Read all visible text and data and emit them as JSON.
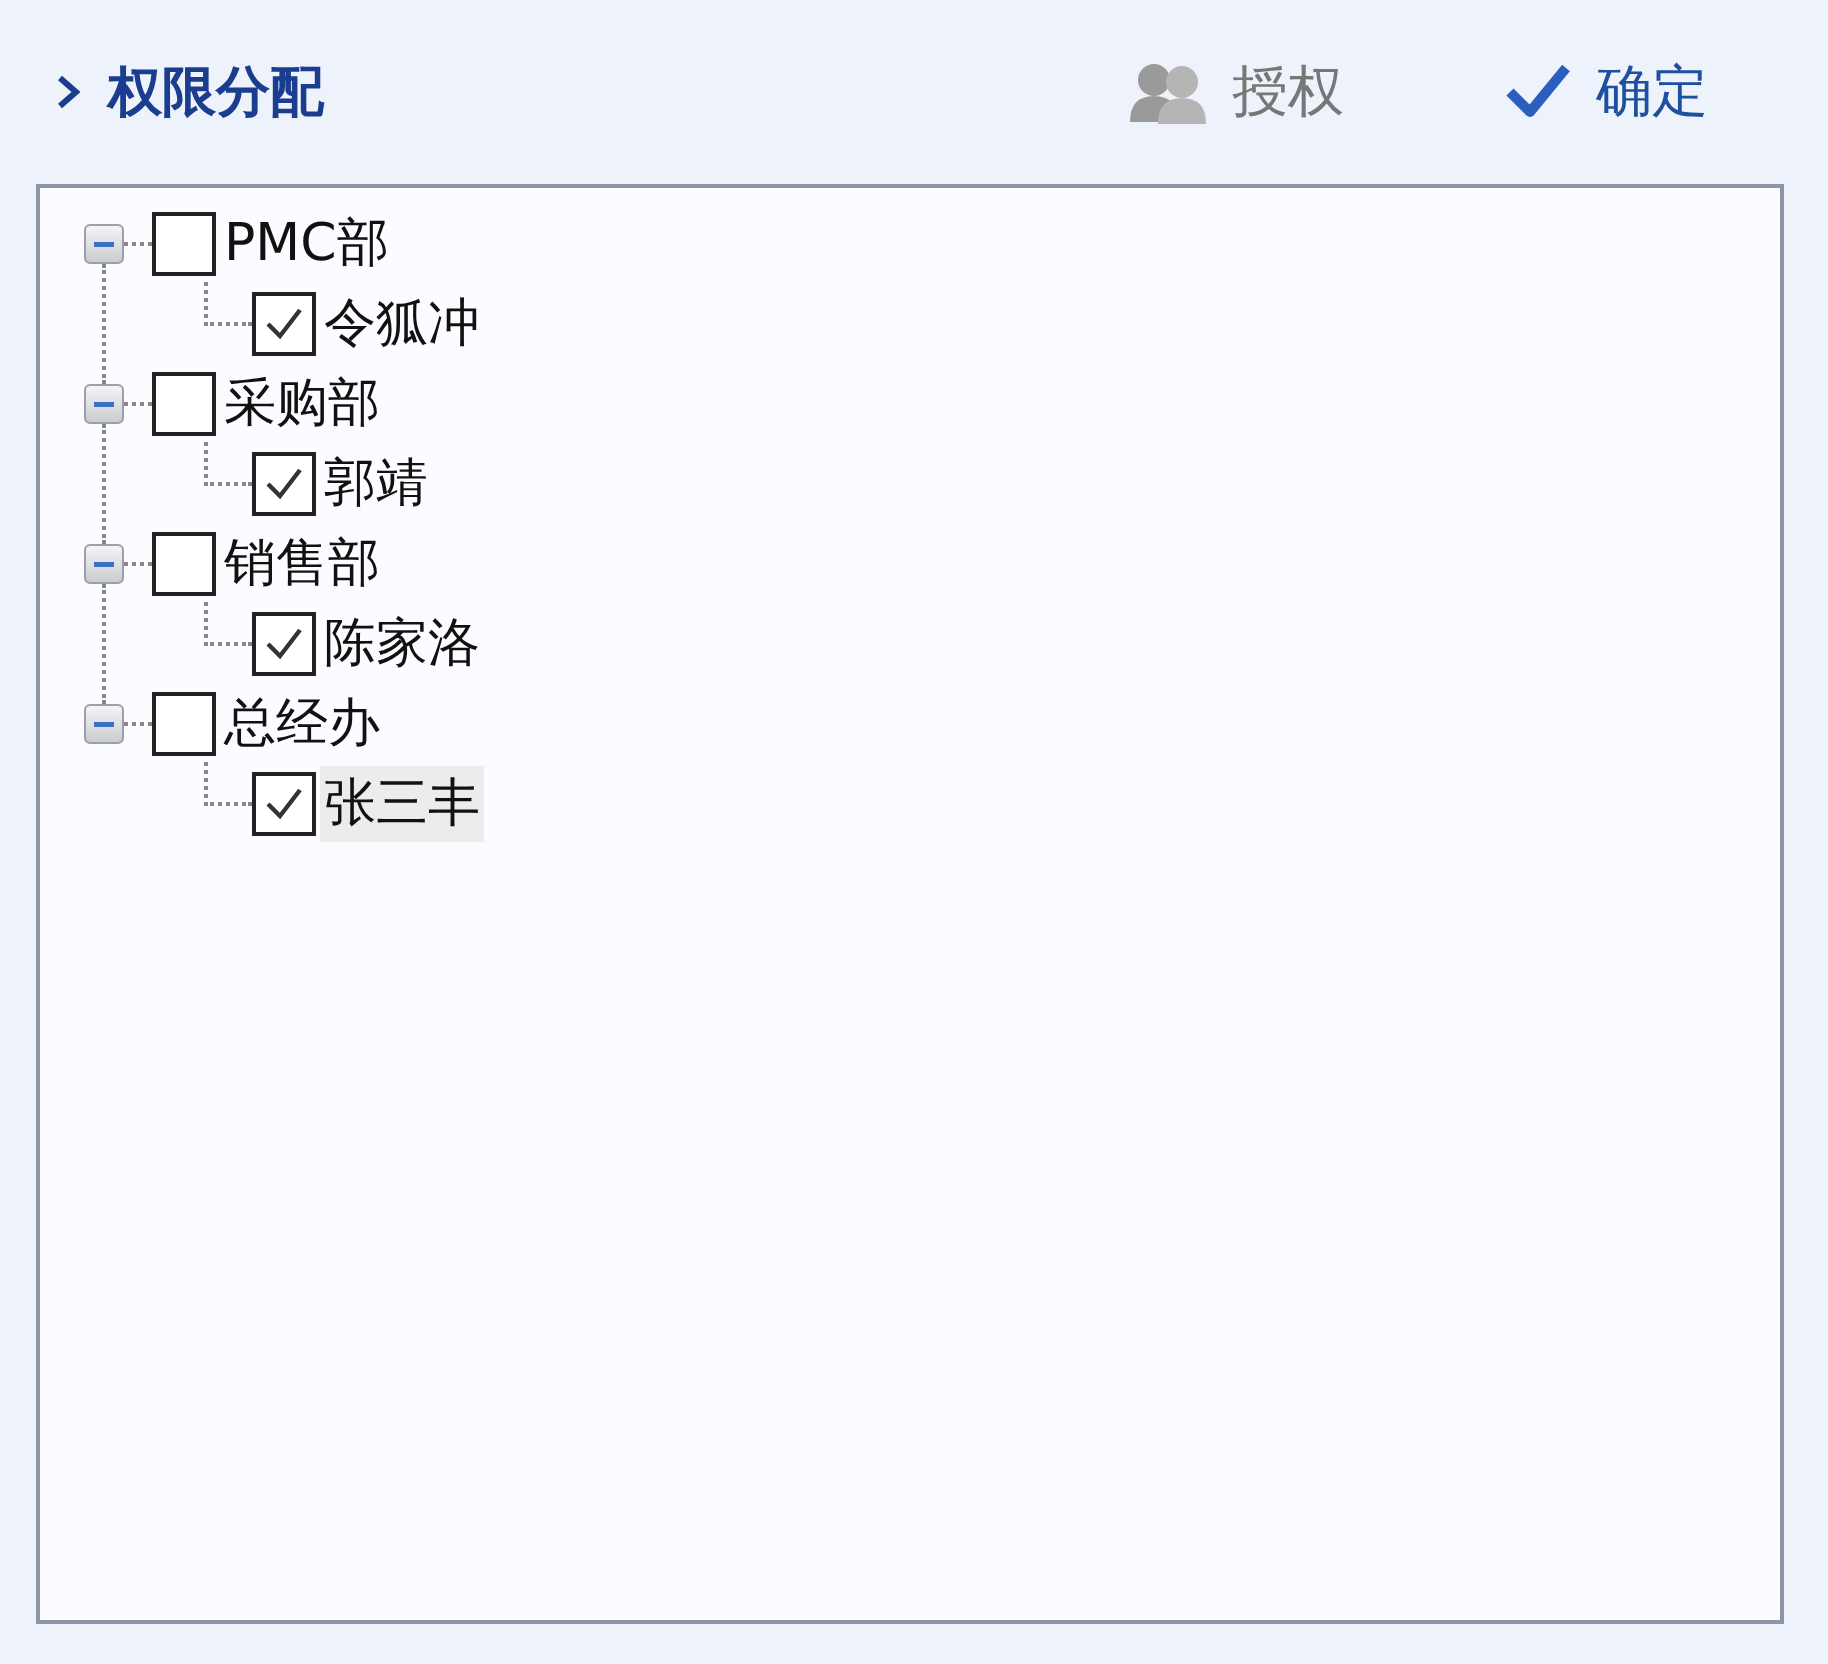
{
  "header": {
    "title": "权限分配",
    "buttons": [
      {
        "kind": "authorize",
        "label": "授权",
        "disabled": true
      },
      {
        "kind": "confirm",
        "label": "确定",
        "disabled": false
      }
    ]
  },
  "tree": {
    "nodes": [
      {
        "label": "PMC部",
        "checked": false,
        "expanded": true,
        "selected": false,
        "children": [
          {
            "label": "令狐冲",
            "checked": true,
            "selected": false
          }
        ]
      },
      {
        "label": "采购部",
        "checked": false,
        "expanded": true,
        "selected": false,
        "children": [
          {
            "label": "郭靖",
            "checked": true,
            "selected": false
          }
        ]
      },
      {
        "label": "销售部",
        "checked": false,
        "expanded": true,
        "selected": false,
        "children": [
          {
            "label": "陈家洛",
            "checked": true,
            "selected": false
          }
        ]
      },
      {
        "label": "总经办",
        "checked": false,
        "expanded": true,
        "selected": false,
        "children": [
          {
            "label": "张三丰",
            "checked": true,
            "selected": true
          }
        ]
      }
    ]
  }
}
